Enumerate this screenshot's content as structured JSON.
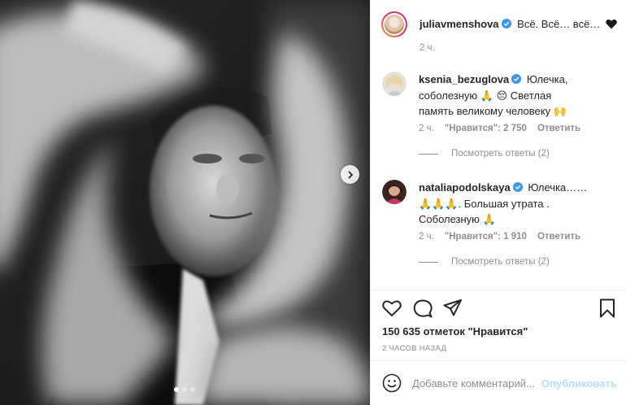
{
  "post": {
    "author": "juliavmenshova",
    "caption": "Всё. Всё… всё…",
    "caption_time": "2 ч.",
    "carousel_dots": 3,
    "active_dot": 1
  },
  "comments": [
    {
      "username": "ksenia_bezuglova",
      "lines": [
        "Юлечка,",
        "соболезную 🙏 😔 Светлая",
        "память великому человеку 🙌"
      ],
      "time": "2 ч.",
      "likes": "\"Нравится\": 2 750",
      "reply": "Ответить",
      "view_replies": "Посмотреть ответы (2)"
    },
    {
      "username": "nataliapodolskaya",
      "lines": [
        "Юлечка……",
        "🙏🙏🙏. Большая утрата .",
        "Соболезную 🙏"
      ],
      "time": "2 ч.",
      "likes": "\"Нравится\": 1 910",
      "reply": "Ответить",
      "view_replies": "Посмотреть ответы (2)"
    }
  ],
  "likes_count": "150 635 отметок \"Нравится\"",
  "posted_ago": "2 ЧАСОВ НАЗАД",
  "composer": {
    "placeholder": "Добавьте комментарий...",
    "publish_label": "Опубликовать"
  },
  "colors": {
    "verified": "#3897f0",
    "muted": "#8e8e8e",
    "publish_disabled": "#b2dffc"
  }
}
